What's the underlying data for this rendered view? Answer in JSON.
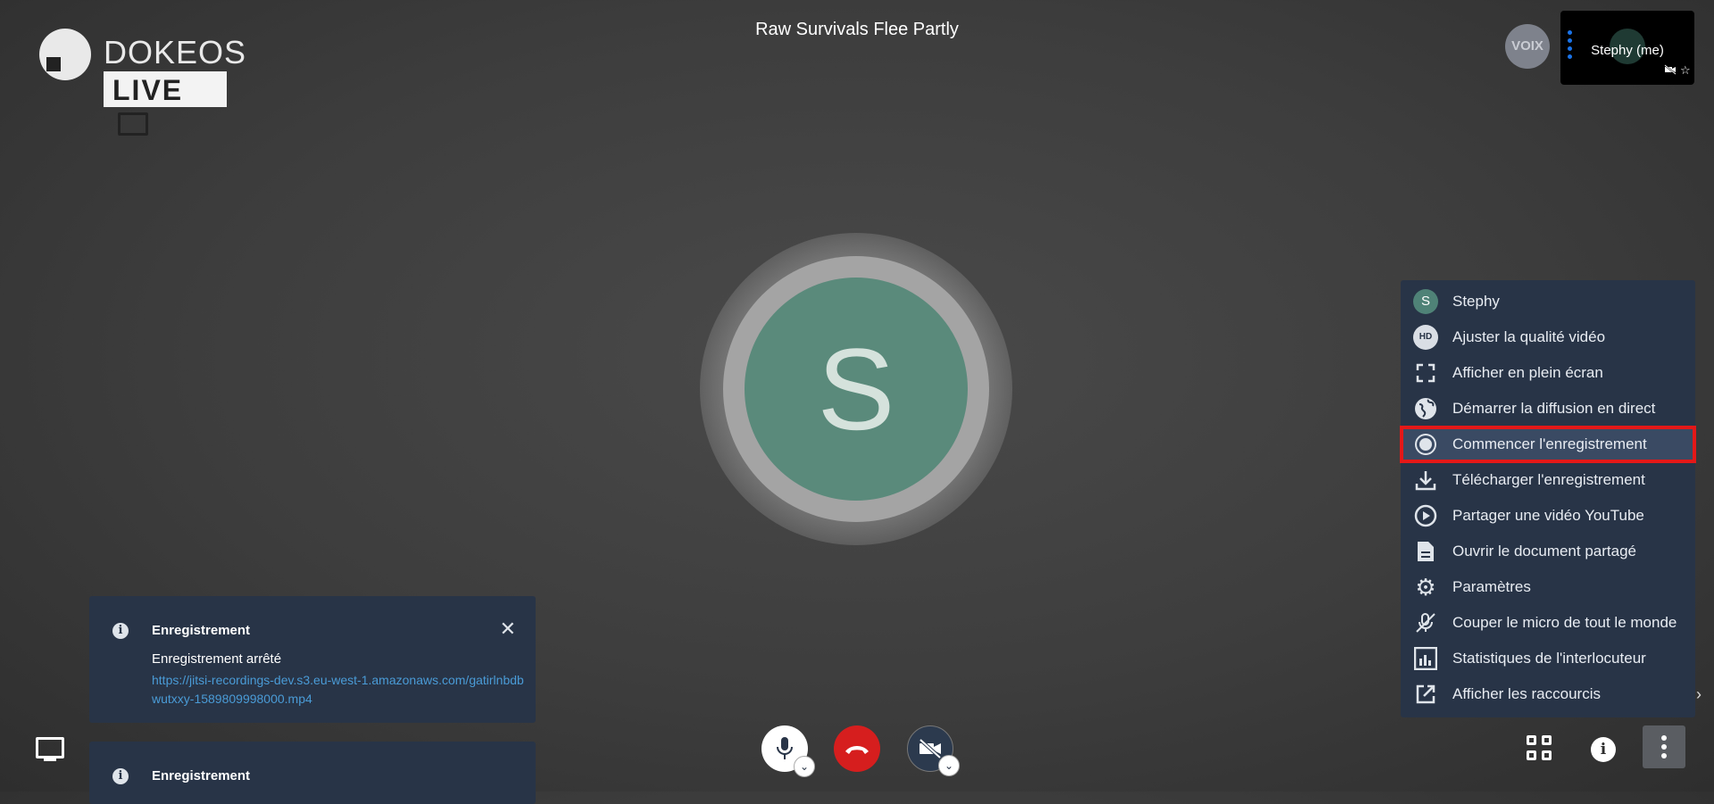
{
  "logo": {
    "wordmark": "DOKEOS",
    "live": "LIVE"
  },
  "meeting": {
    "title": "Raw Survivals Flee Partly"
  },
  "participants": {
    "voix_badge": "VOIX",
    "self_name": "Stephy (me)",
    "self_icons": [
      "muted-camera-icon",
      "star-icon"
    ]
  },
  "main_avatar": {
    "initial": "S",
    "color": "#5a8a7b"
  },
  "more_menu": {
    "items": [
      {
        "label": "Stephy",
        "icon": "user-avatar-icon",
        "avatar_letter": "S"
      },
      {
        "label": "Ajuster la qualité vidéo",
        "icon": "hd-icon",
        "badge": "HD"
      },
      {
        "label": "Afficher en plein écran",
        "icon": "fullscreen-icon"
      },
      {
        "label": "Démarrer la diffusion en direct",
        "icon": "globe-icon"
      },
      {
        "label": "Commencer l'enregistrement",
        "icon": "record-icon",
        "highlighted": true
      },
      {
        "label": "Télécharger l'enregistrement",
        "icon": "download-icon"
      },
      {
        "label": "Partager une vidéo YouTube",
        "icon": "play-circle-icon"
      },
      {
        "label": "Ouvrir le document partagé",
        "icon": "document-icon"
      },
      {
        "label": "Paramètres",
        "icon": "gear-icon"
      },
      {
        "label": "Couper le micro de tout le monde",
        "icon": "mute-all-icon"
      },
      {
        "label": "Statistiques de l'interlocuteur",
        "icon": "stats-icon"
      },
      {
        "label": "Afficher les raccourcis",
        "icon": "external-link-icon"
      }
    ],
    "highlight_color": "#e41818"
  },
  "notifications": [
    {
      "title": "Enregistrement",
      "body": "Enregistrement arrêté",
      "link": "https://jitsi-recordings-dev.s3.eu-west-1.amazonaws.com/gatirlnbdbwutxxy-1589809998000.mp4"
    },
    {
      "title": "Enregistrement"
    }
  ],
  "toolbar": {
    "mic": "microphone-icon",
    "hangup": "hangup-icon",
    "camera": "camera-off-icon",
    "hangup_color": "#d61e1e"
  }
}
